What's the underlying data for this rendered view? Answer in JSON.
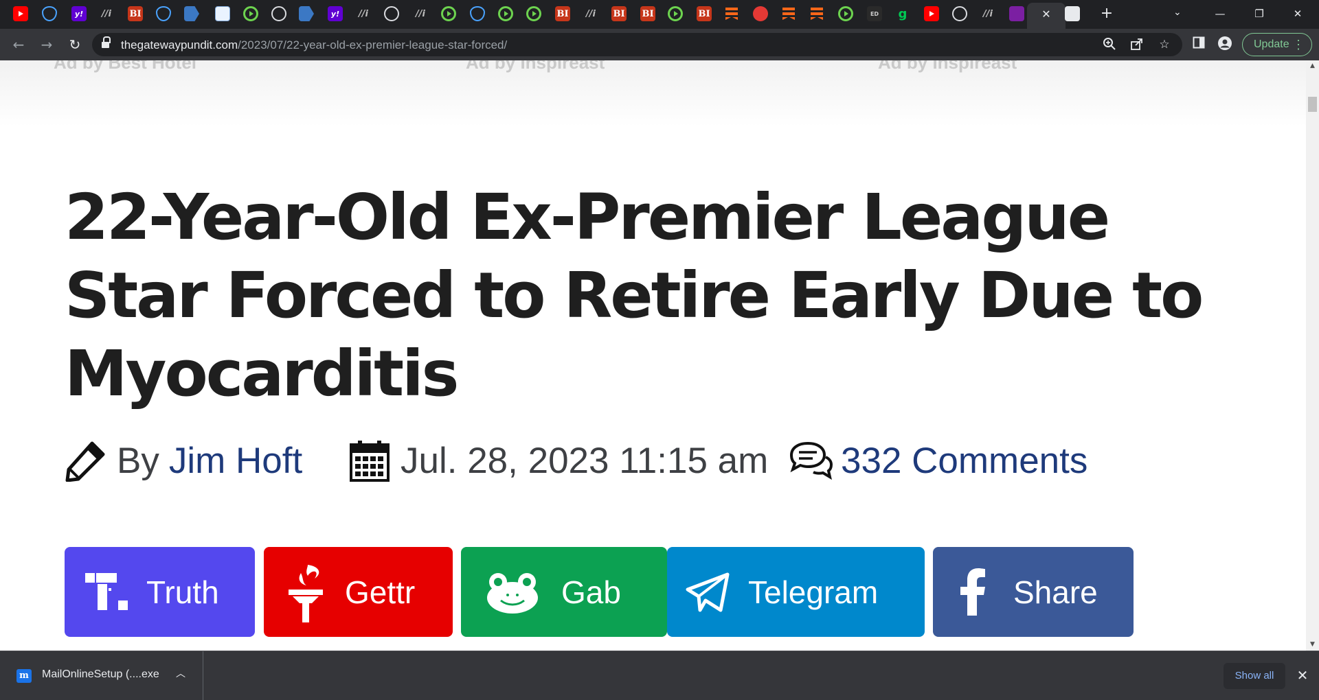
{
  "browser": {
    "tab_favicons": [
      "youtube-icon",
      "shield-icon",
      "yahoo-icon",
      "slash-icon",
      "bi-icon",
      "shield-icon",
      "arrow-icon",
      "grid-icon",
      "play-icon",
      "globe-icon",
      "arrow-icon",
      "yahoo-icon",
      "slash-icon",
      "globe-icon",
      "slash-icon",
      "play-icon",
      "shield-icon",
      "play-icon",
      "play-icon",
      "bi-icon",
      "slash-icon",
      "bi-icon",
      "bi-icon",
      "play-icon",
      "bi-icon",
      "substack-icon",
      "mic-icon",
      "substack-icon",
      "substack-icon",
      "play-icon",
      "editorial-icon",
      "g-icon",
      "youtube-icon",
      "globe-icon",
      "slash-icon",
      "mail-icon",
      "active-tab",
      "lock-icon"
    ],
    "fav_labels": {
      "yahoo": "y!",
      "bi": "BI",
      "slash": "//i",
      "g": "g",
      "editorial": "ED"
    },
    "url_host": "thegatewaypundit.com",
    "url_path": "/2023/07/22-year-old-ex-premier-league-star-forced/",
    "update_label": "Update",
    "accent_update": "#81c995",
    "load_bar_color": "#c8a94e"
  },
  "article": {
    "ad_credits": [
      "Ad by Best Hotel",
      "Ad by Inspireast",
      "Ad by Inspireast"
    ],
    "headline": "22-Year-Old Ex-Premier League Star Forced to Retire Early Due to Myocarditis",
    "by_prefix": "By",
    "author": "Jim Hoft",
    "date": "Jul. 28, 2023 11:15 am",
    "comments": "332 Comments",
    "link_color": "#1e3a7b"
  },
  "share_buttons": [
    {
      "label": "Truth",
      "icon": "truth-social-icon",
      "color": "#5448ee"
    },
    {
      "label": "Gettr",
      "icon": "gettr-torch-icon",
      "color": "#e60000"
    },
    {
      "label": "Gab",
      "icon": "gab-frog-icon",
      "color": "#0ca152"
    },
    {
      "label": "Telegram",
      "icon": "telegram-plane-icon",
      "color": "#0088cc"
    },
    {
      "label": "Share",
      "icon": "facebook-icon",
      "color": "#3b5998"
    }
  ],
  "download_shelf": {
    "file_name": "MailOnlineSetup (....exe",
    "file_icon_glyph": "m",
    "show_all_label": "Show all"
  }
}
